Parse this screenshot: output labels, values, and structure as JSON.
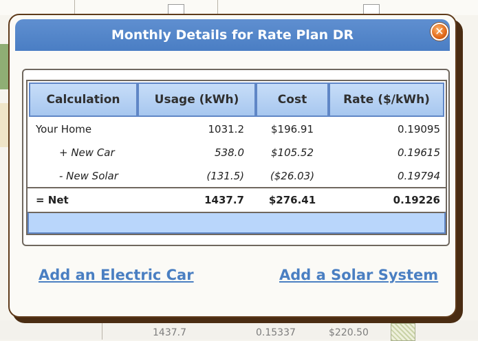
{
  "dialog": {
    "title": "Monthly Details for Rate Plan DR",
    "close_glyph": "✕",
    "close_icon": "close-icon"
  },
  "table": {
    "headers": [
      "Calculation",
      "Usage (kWh)",
      "Cost",
      "Rate ($/kWh)"
    ],
    "rows": [
      {
        "label": "Your Home",
        "usage": "1031.2",
        "cost": "$196.91",
        "rate": "0.19095"
      },
      {
        "label": "+ New Car",
        "usage": "538.0",
        "cost": "$105.52",
        "rate": "0.19615"
      },
      {
        "label": "- New Solar",
        "usage": "(131.5)",
        "cost": "($26.03)",
        "rate": "0.19794"
      }
    ],
    "net": {
      "label": "= Net",
      "usage": "1437.7",
      "cost": "$276.41",
      "rate": "0.19226"
    }
  },
  "links": {
    "add_car": "Add an Electric Car",
    "add_solar": "Add a Solar System"
  },
  "background": {
    "bottom_values": [
      "1437.7",
      "0.15337",
      "$220.50"
    ]
  },
  "colors": {
    "title_bar": "#4a7ec4",
    "header_bg": "#b3d0f3",
    "link": "#4a7fc2",
    "dialog_border": "#5e3a1a",
    "close_button": "#e1691a"
  }
}
